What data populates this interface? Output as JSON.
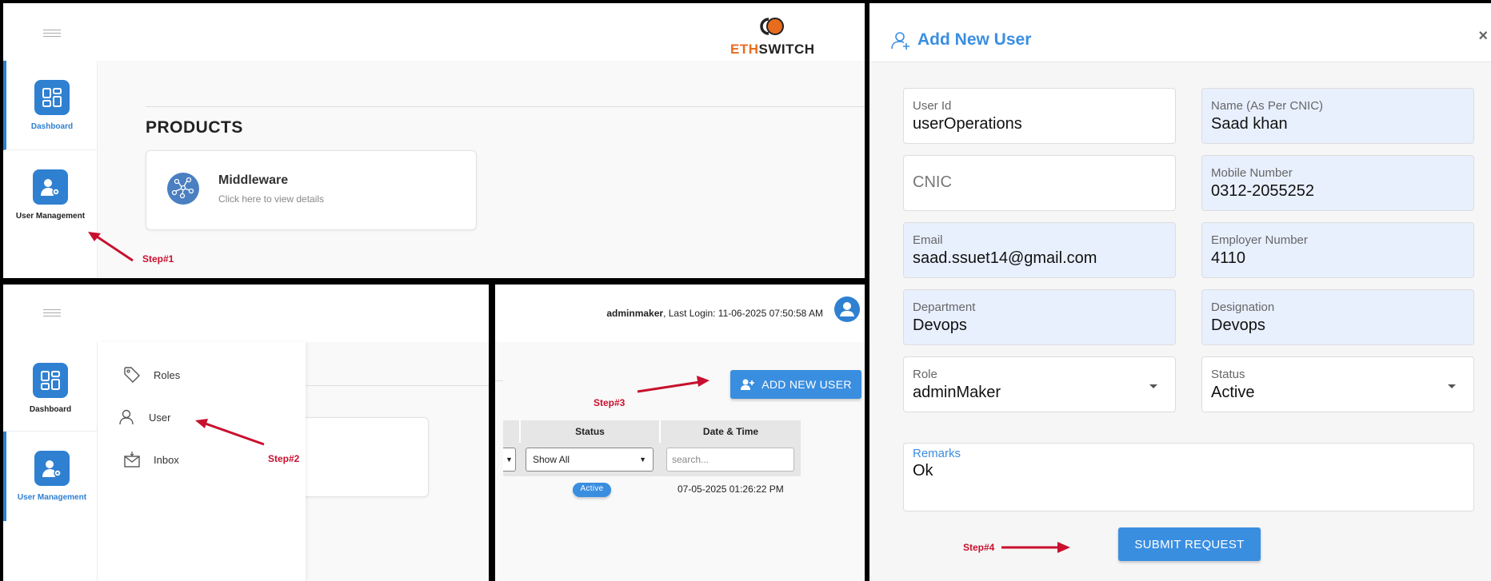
{
  "step1": {
    "sidebar": {
      "dashboard": "Dashboard",
      "user_management": "User Management"
    },
    "logo": {
      "part1": "ETH",
      "part2": "SWITCH"
    },
    "products_title": "PRODUCTS",
    "card": {
      "title": "Middleware",
      "subtitle": "Click here to view details"
    },
    "step_label": "Step#1"
  },
  "step2": {
    "sidebar": {
      "dashboard": "Dashboard",
      "user_management": "User Management"
    },
    "submenu": [
      "Roles",
      "User",
      "Inbox"
    ],
    "card_sub_partial": "etails",
    "step_label": "Step#2"
  },
  "step3": {
    "username": "adminmaker",
    "last_login": ", Last Login: 11-06-2025 07:50:58 AM",
    "add_button": "ADD NEW USER",
    "table": {
      "headers": [
        "Status",
        "Date & Time"
      ],
      "status_filter": "Show All",
      "search_placeholder": "search...",
      "row_date": "07-05-2025 01:26:22 PM",
      "row_status": "Active"
    },
    "step_label": "Step#3"
  },
  "dialog": {
    "title": "Add New User",
    "close": "×",
    "fields": {
      "user_id": {
        "label": "User Id",
        "value": "userOperations"
      },
      "name": {
        "label": "Name (As Per CNIC)",
        "value": "Saad khan"
      },
      "cnic": {
        "placeholder": "CNIC"
      },
      "mobile": {
        "label": "Mobile Number",
        "value": "0312-2055252"
      },
      "email": {
        "label": "Email",
        "value": "saad.ssuet14@gmail.com"
      },
      "employer": {
        "label": "Employer Number",
        "value": "4110"
      },
      "department": {
        "label": "Department",
        "value": "Devops"
      },
      "designation": {
        "label": "Designation",
        "value": "Devops"
      },
      "role": {
        "label": "Role",
        "value": "adminMaker"
      },
      "status": {
        "label": "Status",
        "value": "Active"
      },
      "remarks": {
        "label": "Remarks",
        "value": "Ok"
      }
    },
    "submit": "SUBMIT REQUEST",
    "step_label": "Step#4"
  },
  "colors": {
    "accent": "#3a8ee0",
    "step_red": "#c8102e",
    "brand_orange": "#e86c1e",
    "filled_bg": "#e8f0fe"
  }
}
